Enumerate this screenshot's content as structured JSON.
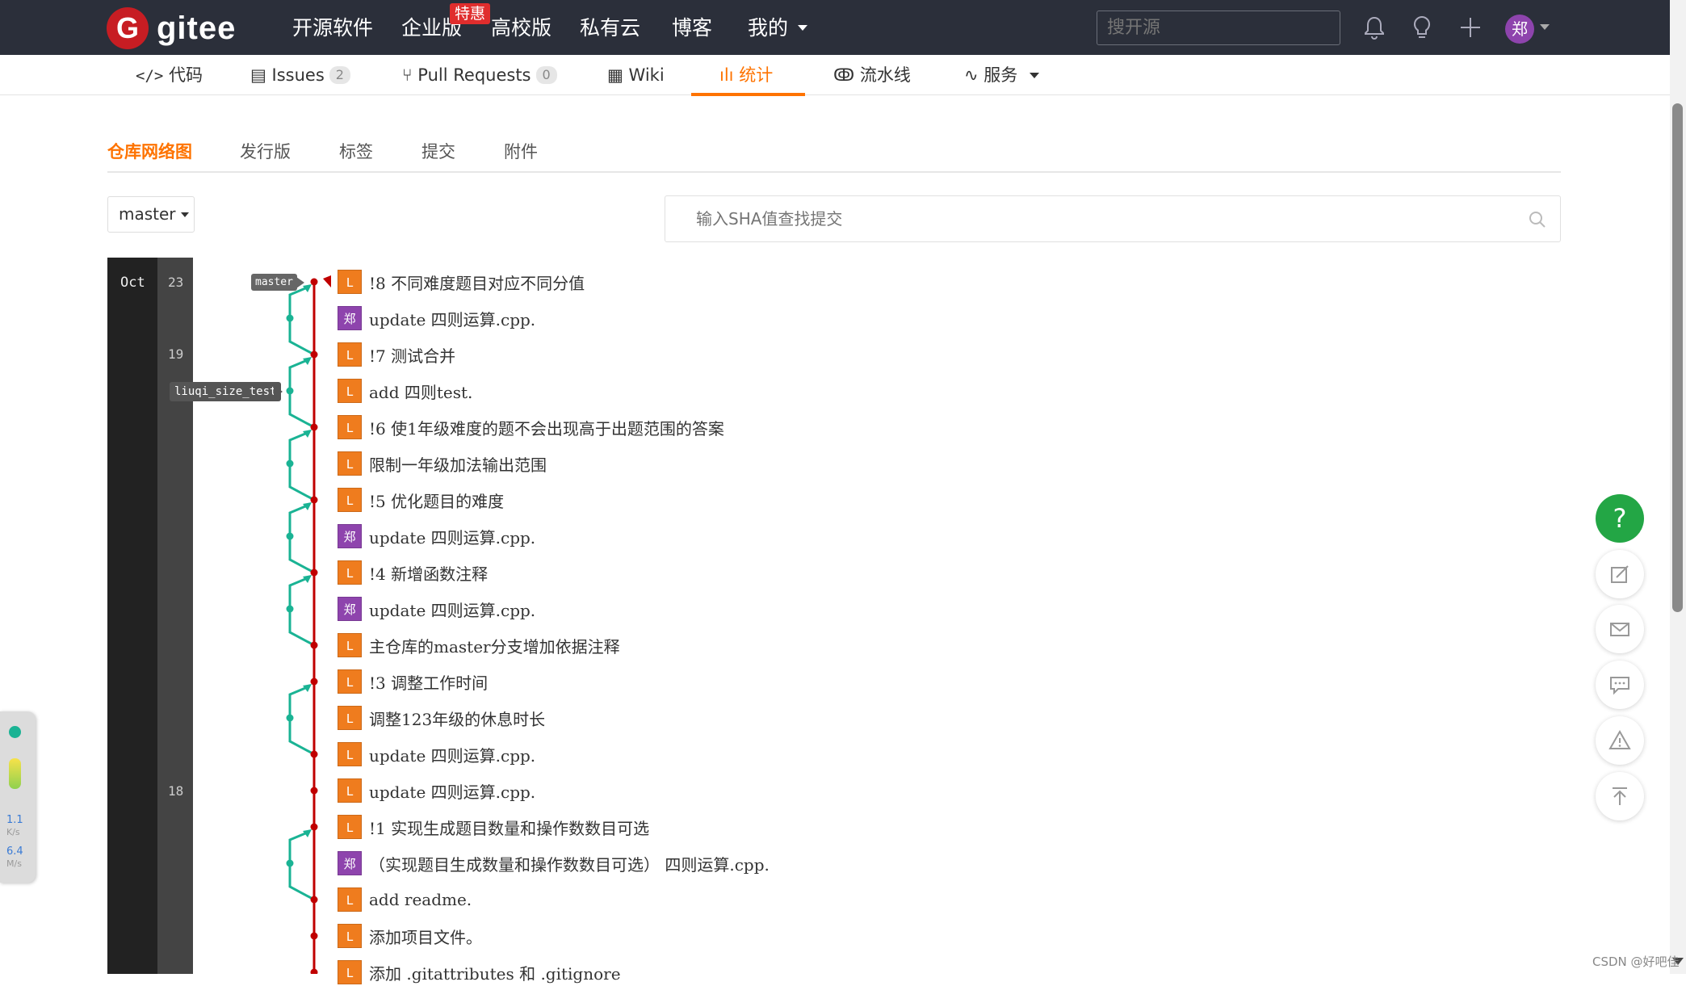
{
  "header": {
    "logo_text": "gitee",
    "logo_glyph": "G",
    "nav": [
      "开源软件",
      "企业版",
      "高校版",
      "私有云",
      "博客",
      "我的"
    ],
    "promo_badge": "特惠",
    "search_placeholder": "搜开源",
    "avatar_char": "郑"
  },
  "repo_tabs": [
    {
      "icon": "code-icon",
      "label": "代码"
    },
    {
      "icon": "issues-icon",
      "label": "Issues",
      "count": "2"
    },
    {
      "icon": "pull-request-icon",
      "label": "Pull Requests",
      "count": "0"
    },
    {
      "icon": "wiki-icon",
      "label": "Wiki"
    },
    {
      "icon": "stats-icon",
      "label": "统计",
      "active": true
    },
    {
      "icon": "pipeline-icon",
      "label": "流水线"
    },
    {
      "icon": "service-icon",
      "label": "服务"
    }
  ],
  "subnav": [
    "仓库网络图",
    "发行版",
    "标签",
    "提交",
    "附件"
  ],
  "branch_select": "master",
  "sha_search_placeholder": "输入SHA值查找提交",
  "timeline": {
    "month": "Oct",
    "days": [
      "23",
      "19",
      "18"
    ]
  },
  "branch_tags": [
    "master",
    "liuqi_size_test"
  ],
  "commits": [
    {
      "avatar": "L",
      "color": "orange",
      "message": "!8 不同难度题目对应不同分值"
    },
    {
      "avatar": "郑",
      "color": "purple",
      "message": "update 四则运算.cpp."
    },
    {
      "avatar": "L",
      "color": "orange",
      "message": "!7 测试合并"
    },
    {
      "avatar": "L",
      "color": "orange",
      "message": "add 四则test."
    },
    {
      "avatar": "L",
      "color": "orange",
      "message": "!6 使1年级难度的题不会出现高于出题范围的答案"
    },
    {
      "avatar": "L",
      "color": "orange",
      "message": "限制一年级加法输出范围"
    },
    {
      "avatar": "L",
      "color": "orange",
      "message": "!5 优化题目的难度"
    },
    {
      "avatar": "郑",
      "color": "purple",
      "message": "update 四则运算.cpp."
    },
    {
      "avatar": "L",
      "color": "orange",
      "message": "!4 新增函数注释"
    },
    {
      "avatar": "郑",
      "color": "purple",
      "message": "update 四则运算.cpp."
    },
    {
      "avatar": "L",
      "color": "orange",
      "message": "主仓库的master分支增加依据注释"
    },
    {
      "avatar": "L",
      "color": "orange",
      "message": "!3 调整工作时间"
    },
    {
      "avatar": "L",
      "color": "orange",
      "message": "调整123年级的休息时长"
    },
    {
      "avatar": "L",
      "color": "orange",
      "message": "update 四则运算.cpp."
    },
    {
      "avatar": "L",
      "color": "orange",
      "message": "update 四则运算.cpp."
    },
    {
      "avatar": "L",
      "color": "orange",
      "message": "!1 实现生成题目数量和操作数数目可选"
    },
    {
      "avatar": "郑",
      "color": "purple",
      "message": "（实现题目生成数量和操作数数目可选） 四则运算.cpp."
    },
    {
      "avatar": "L",
      "color": "orange",
      "message": "add readme."
    },
    {
      "avatar": "L",
      "color": "orange",
      "message": "添加项目文件。"
    },
    {
      "avatar": "L",
      "color": "orange",
      "message": "添加 .gitattributes 和 .gitignore"
    }
  ],
  "net_widget": {
    "up": "1.1",
    "up_unit": "K/s",
    "down": "6.4",
    "down_unit": "M/s"
  },
  "float_buttons": [
    "help-icon",
    "edit-icon",
    "mail-icon",
    "comment-icon",
    "warning-icon",
    "back-to-top-icon"
  ],
  "help_glyph": "?",
  "watermark": "CSDN @好吧佳",
  "colors": {
    "brand": "#c71d23",
    "accent": "#fe7300",
    "graph_main": "#c00000",
    "graph_branch": "#1ab394",
    "help": "#23a645"
  }
}
